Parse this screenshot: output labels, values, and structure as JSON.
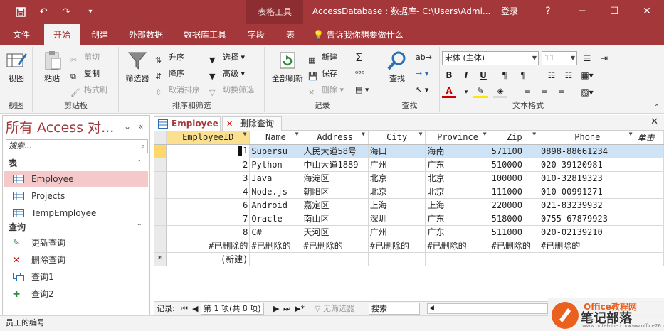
{
  "titlebar": {
    "save_icon": "floppy-icon",
    "undo_icon": "undo-icon",
    "redo_icon": "redo-icon",
    "qa_more": "▾",
    "context_tab": "表格工具",
    "title": "AccessDatabase : 数据库- C:\\Users\\Admi...",
    "login": "登录",
    "help": "?",
    "minimize": "─",
    "maximize": "☐",
    "close": "✕"
  },
  "tabs": [
    "文件",
    "开始",
    "创建",
    "外部数据",
    "数据库工具",
    "字段",
    "表"
  ],
  "active_tab": "开始",
  "tell_me": "告诉我你想要做什么",
  "ribbon": {
    "view": {
      "label": "视图",
      "group": "视图"
    },
    "clipboard": {
      "paste": "粘贴",
      "cut": "剪切",
      "copy": "复制",
      "format_painter": "格式刷",
      "group": "剪贴板"
    },
    "sort_filter": {
      "filter": "筛选器",
      "ascending": "升序",
      "descending": "降序",
      "remove_sort": "取消排序",
      "select": "选择",
      "advanced": "高级",
      "toggle_filter": "切换筛选",
      "group": "排序和筛选"
    },
    "records": {
      "refresh_all": "全部刷新",
      "new": "新建",
      "save": "保存",
      "delete": "删除",
      "group": "记录"
    },
    "find": {
      "find": "查找",
      "group": "查找"
    },
    "text_format": {
      "font": "宋体 (主体)",
      "size": "11",
      "bold": "B",
      "italic": "I",
      "underline": "U",
      "group": "文本格式"
    }
  },
  "nav": {
    "title": "所有 Access 对...",
    "search_placeholder": "搜索...",
    "tables_header": "表",
    "tables": [
      "Employee",
      "Projects",
      "TempEmployee"
    ],
    "selected_table": "Employee",
    "queries_header": "查询",
    "queries": [
      "更新查询",
      "删除查询",
      "查询1",
      "查询2"
    ]
  },
  "doc_tabs": [
    "Employee",
    "删除查询"
  ],
  "sheet": {
    "columns": [
      "EmployeeID",
      "Name",
      "Address",
      "City",
      "Province",
      "Zip",
      "Phone",
      "单击"
    ],
    "rows": [
      [
        "1",
        "Supersu",
        "人民大道58号",
        "海口",
        "海南",
        "571100",
        "0898-88661234"
      ],
      [
        "2",
        "Python",
        "中山大道1889",
        "广州",
        "广东",
        "510000",
        "020-39120981"
      ],
      [
        "3",
        "Java",
        "海淀区",
        "北京",
        "北京",
        "100000",
        "010-32819323"
      ],
      [
        "4",
        "Node.js",
        "朝阳区",
        "北京",
        "北京",
        "111000",
        "010-00991271"
      ],
      [
        "6",
        "Android",
        "嘉定区",
        "上海",
        "上海",
        "220000",
        "021-83239932"
      ],
      [
        "7",
        "Oracle",
        "南山区",
        "深圳",
        "广东",
        "518000",
        "0755-67879923"
      ],
      [
        "8",
        "C#",
        "天河区",
        "广州",
        "广东",
        "511000",
        "020-02139210"
      ],
      [
        "#已删除的",
        "#已删除的",
        "#已删除的",
        "#已删除的",
        "#已删除的",
        "#已删除的",
        "#已删除的"
      ]
    ],
    "new_row": "(新建)",
    "new_marker": "*"
  },
  "recbar": {
    "label": "记录:",
    "first": "⏮",
    "prev": "◀",
    "position": "第 1 项(共 8 项)",
    "next": "▶",
    "last": "⏭",
    "new": "▶*",
    "filter": "无筛选器",
    "search": "搜索"
  },
  "status": "员工的编号",
  "watermark": {
    "line1": "Office教程网",
    "line2": "笔记部落",
    "line3": "www.notetribe.com",
    "url2": "www.office26.com"
  },
  "colors": {
    "brand": "#a4373a",
    "selected_row": "#cfe3f7",
    "nav_selected": "#f5c9ca"
  }
}
